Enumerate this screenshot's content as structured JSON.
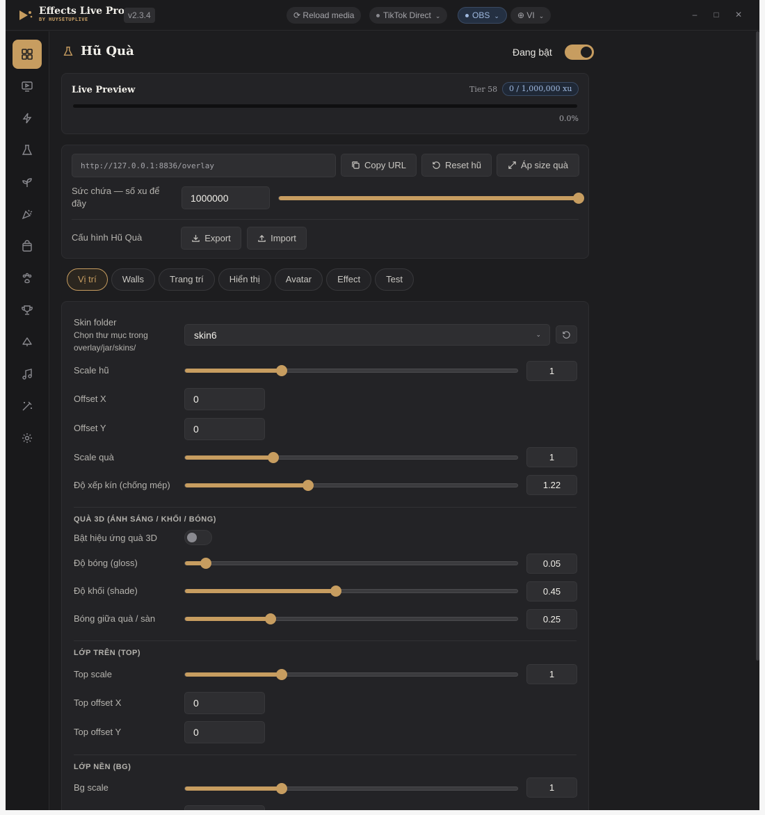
{
  "app": {
    "name": "Effects Live Pro",
    "subtitle": "BY HUYSETUPLIVE",
    "version": "v2.3.4",
    "reload_label": "Reload media",
    "tiktok_label": "TikTok Direct",
    "obs_label": "OBS",
    "lang_label": "VI"
  },
  "page": {
    "title": "Hũ Quà",
    "enabled_label": "Đang bật",
    "enabled": true
  },
  "live_preview": {
    "title": "Live Preview",
    "tier": "Tier 58",
    "badge": "0 / 1,000,000 xu",
    "percent_text": "0.0%",
    "progress": 0
  },
  "config": {
    "url": "http://127.0.0.1:8836/overlay",
    "copy_url": "Copy URL",
    "reset": "Reset hũ",
    "apply_size": "Áp size quà",
    "capacity_label": "Sức chứa — số xu để đầy",
    "capacity_value": "1000000",
    "capacity_slider": 1,
    "jar_config_label": "Cấu hình Hũ Quà",
    "export": "Export",
    "import": "Import"
  },
  "tabs": [
    "Vị trí",
    "Walls",
    "Trang trí",
    "Hiển thị",
    "Avatar",
    "Effect",
    "Test"
  ],
  "position": {
    "skin_label": "Skin folder",
    "skin_hint": "Chọn thư mục trong overlay/jar/skins/",
    "skin_value": "skin6",
    "scale_jar_label": "Scale hũ",
    "scale_jar_value": "1",
    "scale_jar_fraction": 0.29,
    "offset_x_label": "Offset X",
    "offset_x_value": "0",
    "offset_y_label": "Offset Y",
    "offset_y_value": "0",
    "scale_gift_label": "Scale quà",
    "scale_gift_value": "1",
    "scale_gift_fraction": 0.265,
    "pack_label": "Độ xếp kín (chống mép)",
    "pack_value": "1.22",
    "pack_fraction": 0.37
  },
  "gift3d": {
    "title": "QUÀ 3D (ÁNH SÁNG / KHỐI / BÓNG)",
    "enable_label": "Bật hiệu ứng quà 3D",
    "enabled": false,
    "gloss_label": "Độ bóng (gloss)",
    "gloss_value": "0.05",
    "gloss_fraction": 0.063,
    "shade_label": "Độ khối (shade)",
    "shade_value": "0.45",
    "shade_fraction": 0.453,
    "shadow_label": "Bóng giữa quà / sàn",
    "shadow_value": "0.25",
    "shadow_fraction": 0.258
  },
  "top_layer": {
    "title": "LỚP TRÊN (TOP)",
    "scale_label": "Top scale",
    "scale_value": "1",
    "scale_fraction": 0.29,
    "offset_x_label": "Top offset X",
    "offset_x_value": "0",
    "offset_y_label": "Top offset Y",
    "offset_y_value": "0"
  },
  "bg_layer": {
    "title": "LỚP NỀN (BG)",
    "scale_label": "Bg scale",
    "scale_value": "1",
    "scale_fraction": 0.29
  },
  "colors": {
    "accent": "#c79d60",
    "background": "#1d1d1f",
    "card": "#232326",
    "obs": "#9fb9df"
  },
  "nav_icons": [
    "dashboard-icon",
    "monitor-play-icon",
    "lightning-icon",
    "flask-icon",
    "sprout-icon",
    "party-popper-icon",
    "shopping-bag-icon",
    "paw-icon",
    "trophy-icon",
    "cloud-icon",
    "music-icon",
    "magic-wand-icon",
    "gear-icon"
  ]
}
